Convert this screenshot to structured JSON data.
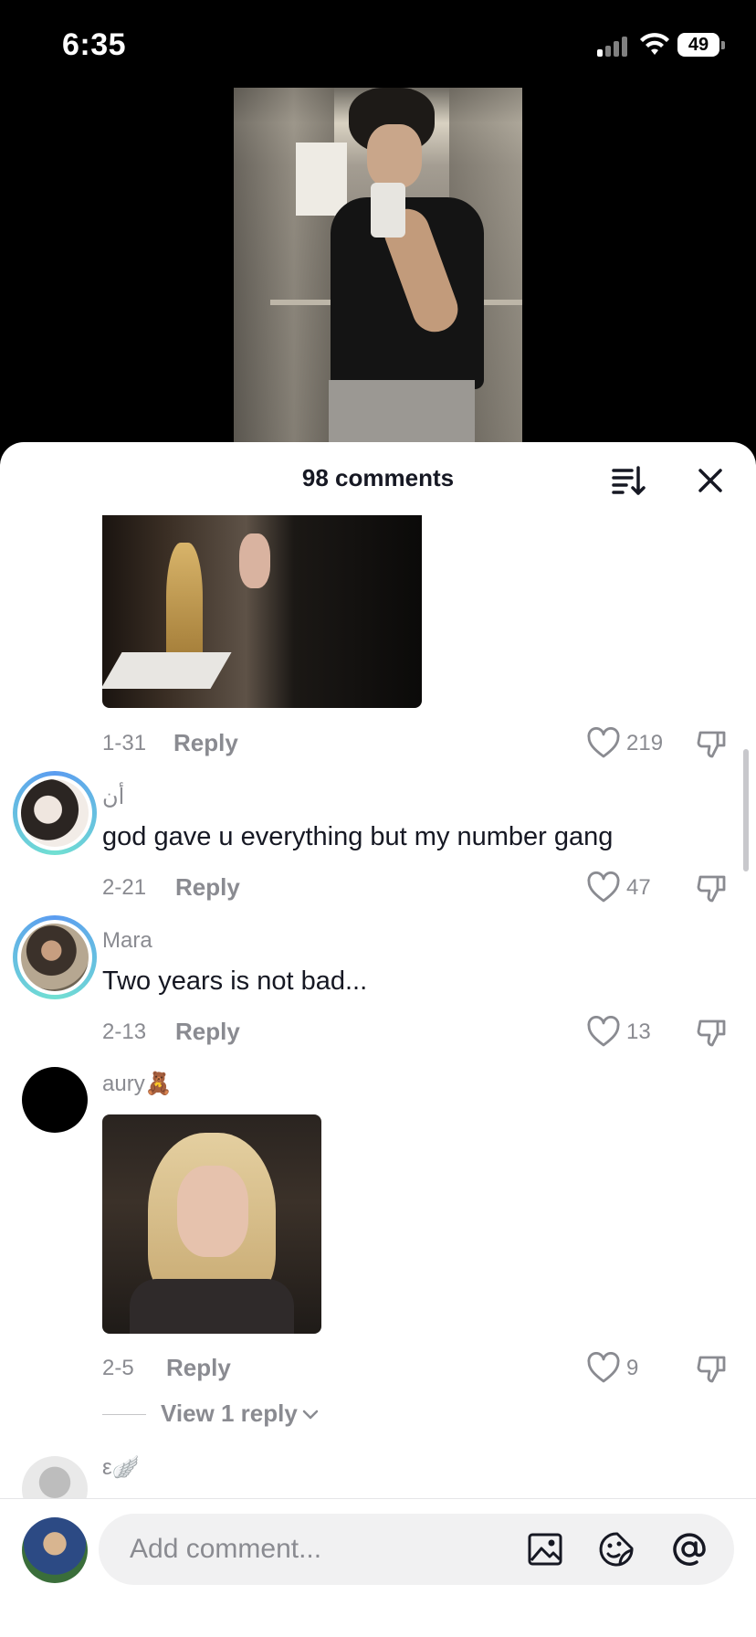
{
  "status_bar": {
    "time": "6:35",
    "battery": "49"
  },
  "sheet": {
    "title": "98 comments"
  },
  "comments": [
    {
      "date": "1-31",
      "reply_label": "Reply",
      "likes": "219"
    },
    {
      "username": "أن",
      "text": "god gave u everything but my number gang",
      "date": "2-21",
      "reply_label": "Reply",
      "likes": "47"
    },
    {
      "username": "Mara",
      "text": "Two years is not bad...",
      "date": "2-13",
      "reply_label": "Reply",
      "likes": "13"
    },
    {
      "username": "aury🧸",
      "date": "2-5",
      "reply_label": "Reply",
      "likes": "9",
      "view_replies": "View 1 reply"
    },
    {
      "username": "ε🪽"
    }
  ],
  "input": {
    "placeholder": "Add comment..."
  },
  "icons": {
    "sort": "sort-icon",
    "close": "close-icon",
    "like": "heart-icon",
    "dislike": "thumbs-down-icon",
    "image": "image-icon",
    "emoji": "emoji-icon",
    "mention": "at-icon"
  }
}
